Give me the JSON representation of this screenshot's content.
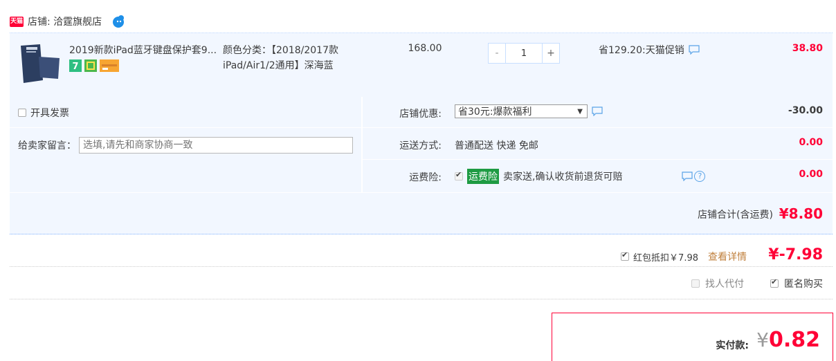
{
  "shop": {
    "badge": "天猫",
    "label": "店铺: 洽霆旗舰店"
  },
  "item": {
    "title": "2019新款iPad蓝牙键盘保护套9....",
    "sku": "颜色分类：【2018/2017款iPad/Air1/2通用】深海蓝",
    "price": "168.00",
    "qty_minus": "-",
    "qty": "1",
    "qty_plus": "+",
    "promo": "省129.20:天猫促销",
    "subtotal": "38.80"
  },
  "invoice": {
    "label": "开具发票"
  },
  "message": {
    "label": "给卖家留言：",
    "placeholder": "选填,请先和商家协商一致"
  },
  "shop_discount": {
    "label": "店铺优惠:",
    "selected": "省30元:爆款福利",
    "amount": "-30.00"
  },
  "shipping": {
    "label": "运送方式:",
    "value": "普通配送 快递 免邮",
    "amount": "0.00"
  },
  "insurance": {
    "label": "运费险:",
    "tag": "运费险",
    "desc": "卖家送,确认收货前退货可赔",
    "help": "?",
    "amount": "0.00"
  },
  "shop_total": {
    "label": "店铺合计(含运费)",
    "value": "¥8.80"
  },
  "red_envelope": {
    "label": "红包抵扣￥7.98",
    "link": "查看详情",
    "value": "¥-7.98"
  },
  "options": {
    "proxy_pay": "找人代付",
    "anonymous": "匿名购买"
  },
  "payment": {
    "label": "实付款:",
    "currency": "¥",
    "value": "0.82"
  },
  "colors": {
    "accent": "#ff0036",
    "panel": "#f2f7ff",
    "link": "#c0803d",
    "insurance": "#1e9b43"
  }
}
